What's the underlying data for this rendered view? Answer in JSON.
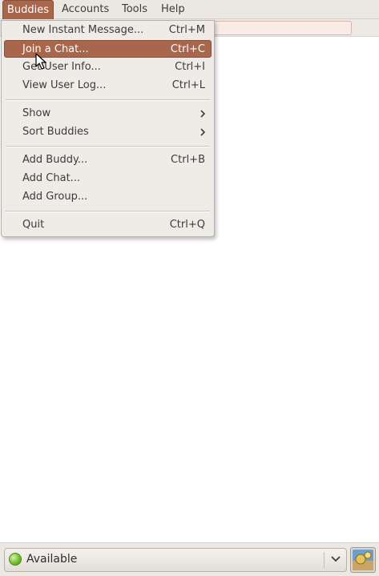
{
  "menubar": {
    "items": [
      {
        "label": "Buddies",
        "active": true
      },
      {
        "label": "Accounts",
        "active": false
      },
      {
        "label": "Tools",
        "active": false
      },
      {
        "label": "Help",
        "active": false
      }
    ]
  },
  "buddies_menu": {
    "group1": [
      {
        "label": "New Instant Message...",
        "accel": "Ctrl+M"
      },
      {
        "label": "Join a Chat...",
        "accel": "Ctrl+C",
        "highlighted": true
      },
      {
        "label": "Get User Info...",
        "accel": "Ctrl+I"
      },
      {
        "label": "View User Log...",
        "accel": "Ctrl+L"
      }
    ],
    "group2": [
      {
        "label": "Show",
        "submenu": true
      },
      {
        "label": "Sort Buddies",
        "submenu": true
      }
    ],
    "group3": [
      {
        "label": "Add Buddy...",
        "accel": "Ctrl+B"
      },
      {
        "label": "Add Chat...",
        "accel": ""
      },
      {
        "label": "Add Group...",
        "accel": ""
      }
    ],
    "group4": [
      {
        "label": "Quit",
        "accel": "Ctrl+Q"
      }
    ]
  },
  "status": {
    "label": "Available",
    "color": "#73c02d"
  },
  "colors": {
    "accent": "#a8664c",
    "menu_bg": "#efebe7",
    "bar_bg": "#ebe7e1"
  },
  "icons": {
    "status": "available-status-icon",
    "dropdown": "chevron-down-icon",
    "avatar": "buddy-icon-button",
    "submenu": "chevron-right-icon"
  }
}
